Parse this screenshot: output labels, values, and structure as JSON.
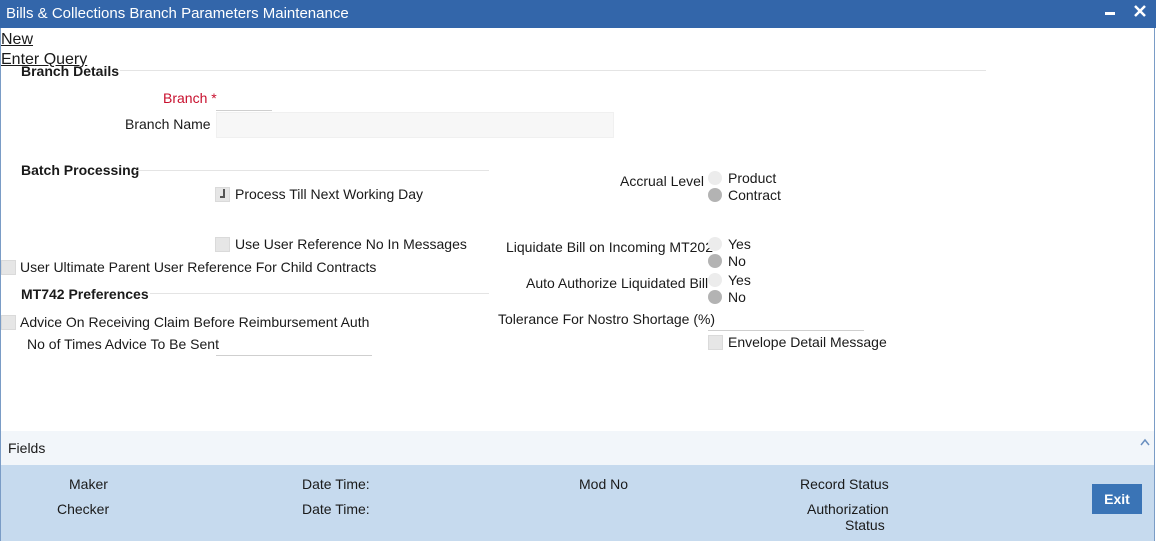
{
  "window": {
    "title": "Bills & Collections Branch Parameters Maintenance",
    "minimize_icon": "minimize-icon",
    "close_icon": "close-icon"
  },
  "menu": {
    "new_label": "New",
    "enter_query_label": "Enter Query"
  },
  "branch_details": {
    "heading": "Branch Details",
    "branch_label": "Branch",
    "required_mark": "*",
    "branch_value": "",
    "branch_name_label": "Branch Name",
    "branch_name_value": ""
  },
  "batch_processing": {
    "heading": "Batch Processing",
    "process_till_next_working_day": {
      "label": "Process Till Next Working Day",
      "checked": true
    },
    "use_user_reference": {
      "label": "Use User Reference No In Messages",
      "checked": false
    },
    "user_ultimate_parent": {
      "label": "User Ultimate Parent User Reference For Child Contracts",
      "checked": false
    }
  },
  "accrual": {
    "label": "Accrual Level",
    "options": [
      "Product",
      "Contract"
    ],
    "selected": "Contract"
  },
  "liquidate_mt202": {
    "label": "Liquidate Bill on Incoming MT202",
    "options": [
      "Yes",
      "No"
    ],
    "selected": "No"
  },
  "auto_authorize": {
    "label": "Auto Authorize Liquidated Bill",
    "options": [
      "Yes",
      "No"
    ],
    "selected": "No"
  },
  "tolerance": {
    "label": "Tolerance For Nostro Shortage (%)",
    "value": ""
  },
  "envelope": {
    "label": "Envelope Detail Message",
    "checked": false
  },
  "mt742": {
    "heading": "MT742 Preferences",
    "advice_on_receiving_claim": {
      "label": "Advice On Receiving Claim Before Reimbursement Auth",
      "checked": false
    },
    "times_advice_label": "No of Times Advice To Be Sent",
    "times_advice_value": ""
  },
  "fields_bar": {
    "label": "Fields",
    "collapse_icon": "chevron-up-icon"
  },
  "footer": {
    "maker": "Maker",
    "checker": "Checker",
    "date_time_1": "Date Time:",
    "date_time_2": "Date Time:",
    "mod_no": "Mod No",
    "record_status": "Record Status",
    "authorization_status_line1": "Authorization",
    "authorization_status_line2": "Status",
    "exit_label": "Exit"
  }
}
